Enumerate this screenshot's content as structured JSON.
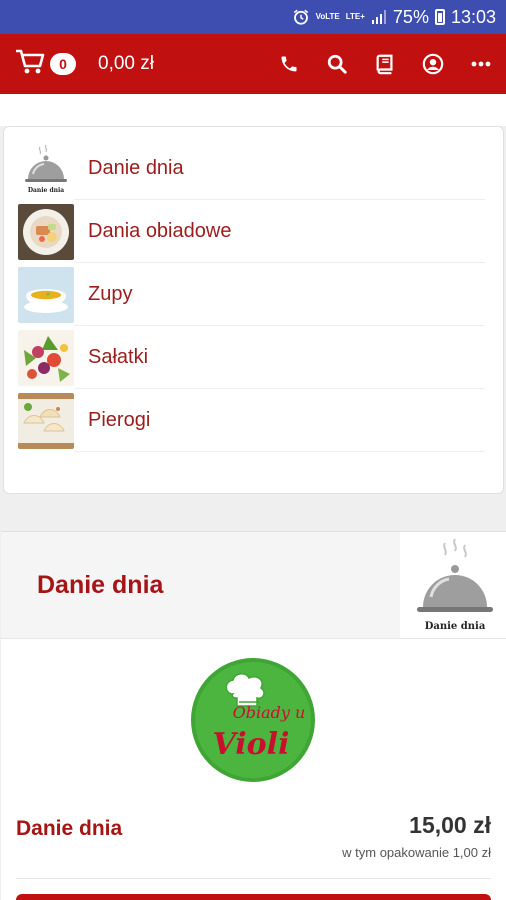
{
  "status_bar": {
    "network_label": "VoLTE",
    "lte_label": "LTE+",
    "battery": "75%",
    "time": "13:03"
  },
  "toolbar": {
    "cart_count": "0",
    "cart_total": "0,00 zł",
    "icons": [
      "cart-icon",
      "phone-icon",
      "search-icon",
      "book-icon",
      "account-icon",
      "more-icon"
    ]
  },
  "categories": [
    {
      "label": "Danie dnia",
      "thumb_text": "Danie dnia"
    },
    {
      "label": "Dania obiadowe"
    },
    {
      "label": "Zupy"
    },
    {
      "label": "Sałatki"
    },
    {
      "label": "Pierogi"
    }
  ],
  "section": {
    "title": "Danie dnia",
    "image_caption": "Danie dnia"
  },
  "logo": {
    "line1": "Obiady u",
    "line2": "Violi"
  },
  "product": {
    "name": "Danie dnia",
    "price": "15,00 zł",
    "note": "w tym opakowanie 1,00 zł"
  },
  "colors": {
    "primary": "#c11010",
    "status_bar": "#3d4db0",
    "text_red": "#a51515"
  }
}
